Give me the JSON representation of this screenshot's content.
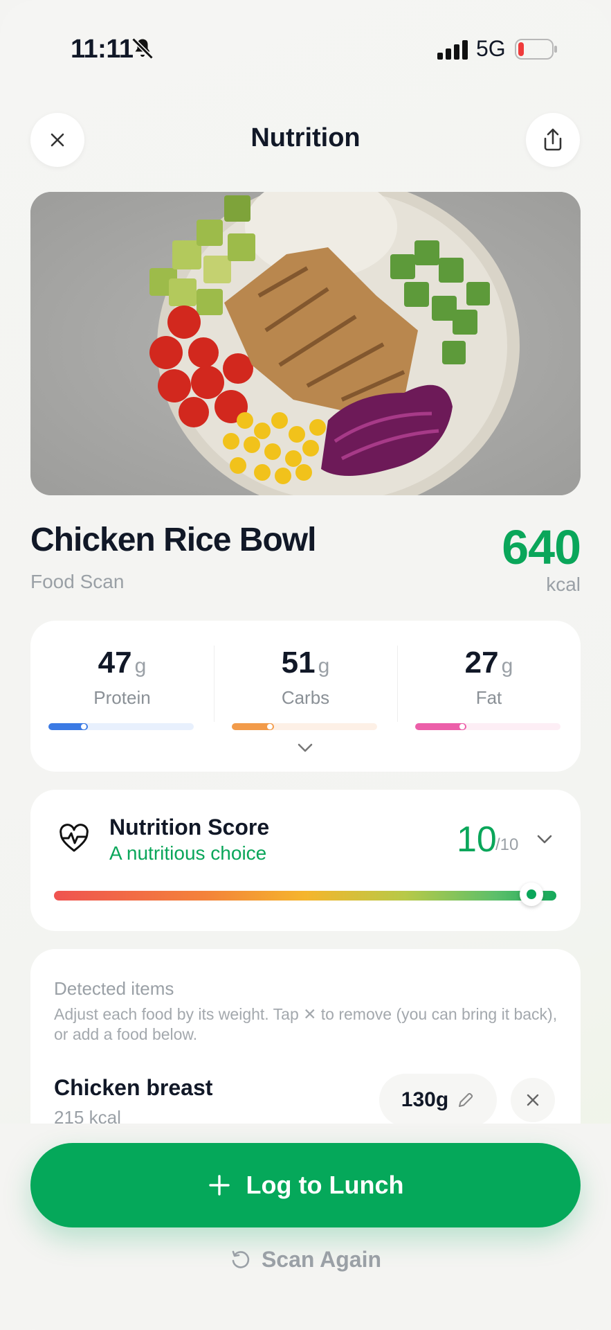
{
  "status_bar": {
    "time": "11:11",
    "network": "5G"
  },
  "header": {
    "title": "Nutrition"
  },
  "food": {
    "name": "Chicken Rice Bowl",
    "source": "Food Scan",
    "kcal": "640",
    "kcal_unit": "kcal"
  },
  "macros": [
    {
      "value": "47",
      "unit": "g",
      "label": "Protein",
      "color": "#3b7ae4",
      "track": "#e8f0fd",
      "progress": 0.27
    },
    {
      "value": "51",
      "unit": "g",
      "label": "Carbs",
      "color": "#f29b4a",
      "track": "#fdf0e6",
      "progress": 0.29
    },
    {
      "value": "27",
      "unit": "g",
      "label": "Fat",
      "color": "#ec5fa9",
      "track": "#fdeef5",
      "progress": 0.35
    }
  ],
  "score": {
    "title": "Nutrition Score",
    "subtitle": "A nutritious choice",
    "value": "10",
    "max": "/10",
    "level": 0.95
  },
  "detected": {
    "title": "Detected items",
    "help": "Adjust each food by its weight. Tap ✕ to remove (you can bring it back), or add a food below.",
    "items": [
      {
        "name": "Chicken breast",
        "kcal": "215 kcal",
        "weight": "130g"
      }
    ]
  },
  "actions": {
    "log_label": "Log to Lunch",
    "scan_again_label": "Scan Again"
  },
  "colors": {
    "accent": "#05a85a"
  }
}
